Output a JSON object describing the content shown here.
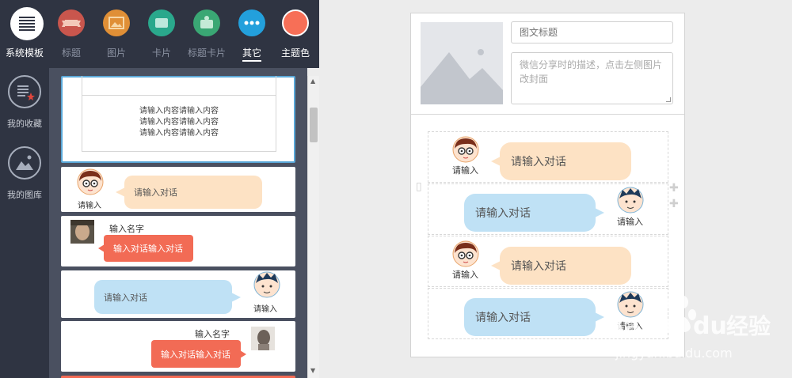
{
  "toolbar": {
    "items": [
      {
        "label": "系统模板",
        "icon": "list-icon"
      },
      {
        "label": "标题",
        "icon": "banner-icon",
        "color": "#c9564d"
      },
      {
        "label": "图片",
        "icon": "image-icon",
        "color": "#e08f36"
      },
      {
        "label": "卡片",
        "icon": "card-icon",
        "color": "#2aa88c"
      },
      {
        "label": "标题卡片",
        "icon": "title-card-icon",
        "color": "#3aa774"
      },
      {
        "label": "其它",
        "icon": "more-icon",
        "color": "#23a0dc"
      },
      {
        "label": "主题色",
        "icon": "theme-color-icon",
        "color": "#f76f57"
      }
    ]
  },
  "sidebar": {
    "items": [
      {
        "label": "我的收藏",
        "icon": "favorites-icon"
      },
      {
        "label": "我的图库",
        "icon": "gallery-icon"
      }
    ]
  },
  "templates": {
    "card1_lines": [
      "请输入内容请输入内容",
      "请输入内容请输入内容",
      "请输入内容请输入内容"
    ],
    "chat_left_label": "请输入",
    "chat_left_text": "请输入对话",
    "chat_name_left": "输入名字",
    "chat_red_left": "输入对话输入对话",
    "chat_right_text": "请输入对话",
    "chat_right_label": "请输入",
    "chat_name_right": "输入名字",
    "chat_red_right": "输入对话输入对话"
  },
  "preview": {
    "title_placeholder": "图文标题",
    "desc_placeholder": "微信分享时的描述，点击左侧图片改封面",
    "rows": [
      {
        "side": "left",
        "text": "请输入对话",
        "label": "请输入"
      },
      {
        "side": "right",
        "text": "请输入对话",
        "label": "请输入"
      },
      {
        "side": "left",
        "text": "请输入对话",
        "label": "请输入"
      },
      {
        "side": "right",
        "text": "请输入对话",
        "label": "请输入"
      }
    ]
  },
  "watermark": {
    "brand": "Bai",
    "brand2": "du",
    "cn": "经验",
    "url": "jingyan.baidu.com"
  },
  "colors": {
    "peach": "#fde2c4",
    "blue": "#bfe1f5",
    "red": "#f26b55",
    "dark": "#2f3442"
  }
}
